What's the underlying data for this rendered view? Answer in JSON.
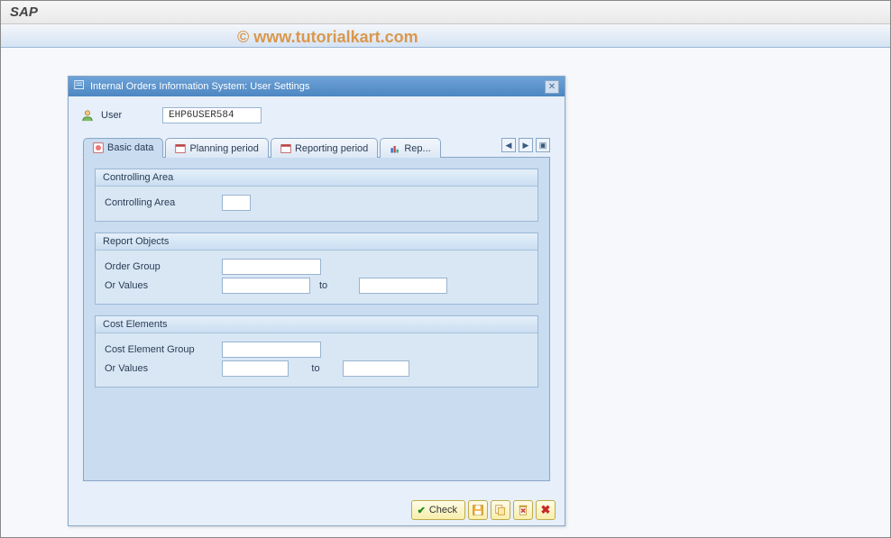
{
  "app": {
    "title": "SAP"
  },
  "watermark": "© www.tutorialkart.com",
  "dialog": {
    "title": "Internal Orders Information System: User Settings",
    "user_label": "User",
    "user_value": "EHP6USER584"
  },
  "tabs": {
    "items": [
      {
        "label": "Basic data"
      },
      {
        "label": "Planning period"
      },
      {
        "label": "Reporting period"
      },
      {
        "label": "Rep..."
      }
    ]
  },
  "groups": {
    "controlling": {
      "title": "Controlling Area",
      "fields": {
        "controlling_area": "Controlling Area"
      }
    },
    "report": {
      "title": "Report Objects",
      "fields": {
        "order_group": "Order Group",
        "or_values": "Or Values",
        "to": "to"
      }
    },
    "cost": {
      "title": "Cost Elements",
      "fields": {
        "group": "Cost Element Group",
        "or_values": "Or Values",
        "to": "to"
      }
    }
  },
  "footer": {
    "check": "Check"
  }
}
